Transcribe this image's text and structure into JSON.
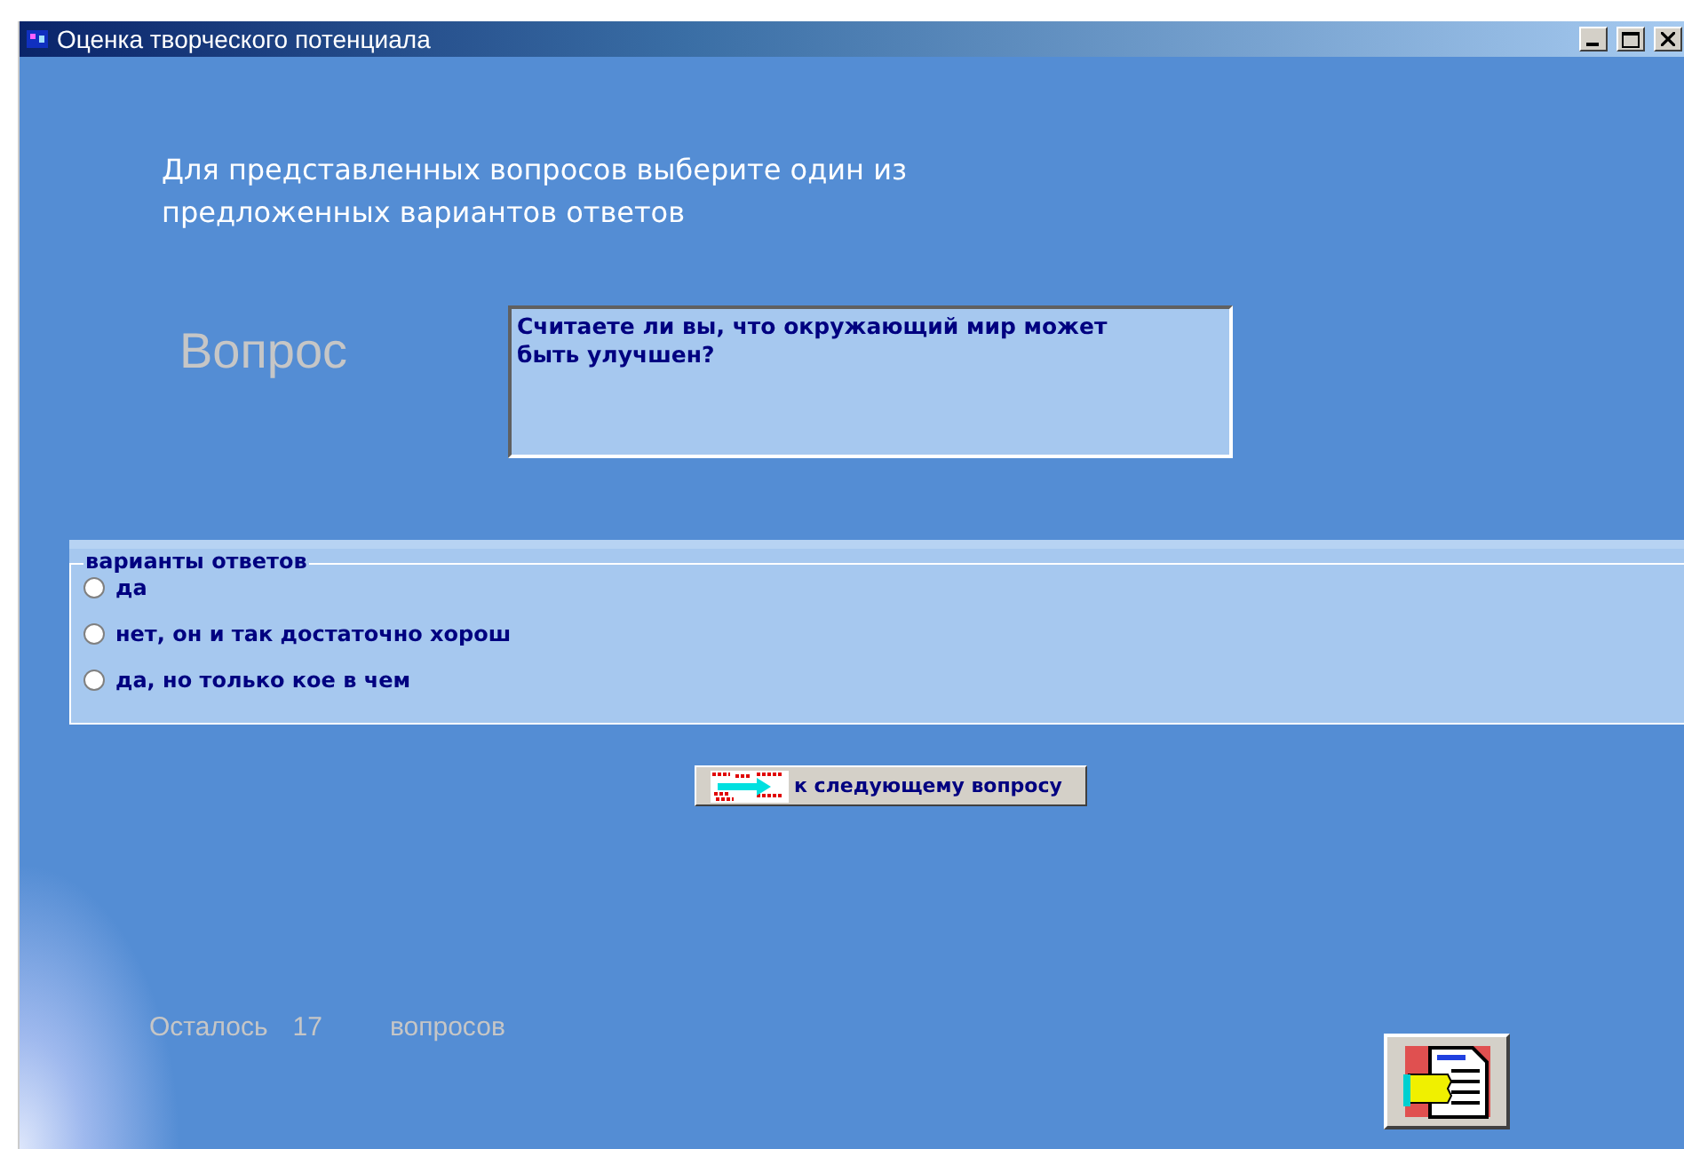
{
  "window": {
    "title": "Оценка творческого потенциала"
  },
  "instruction": "Для представленных вопросов выберите один из предложенных вариантов ответов",
  "question_label": "Вопрос",
  "question_text": "Считаете ли вы, что окружающий мир может быть улучшен?",
  "answers": {
    "legend": "варианты ответов",
    "options": [
      {
        "label": "да",
        "selected": false
      },
      {
        "label": "нет, он и так достаточно хорош",
        "selected": false
      },
      {
        "label": "да, но только кое в чем",
        "selected": false
      }
    ]
  },
  "next_button": {
    "label": "к следующему вопросу"
  },
  "remaining": {
    "prefix": "Осталось",
    "count": "17",
    "suffix": "вопросов"
  }
}
